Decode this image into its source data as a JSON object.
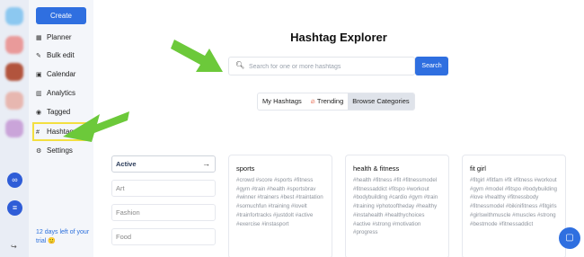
{
  "sidebar": {
    "create_label": "Create",
    "items": [
      {
        "label": "Planner",
        "icon": "grid-icon"
      },
      {
        "label": "Bulk edit",
        "icon": "edit-icon"
      },
      {
        "label": "Calendar",
        "icon": "calendar-icon"
      },
      {
        "label": "Analytics",
        "icon": "chart-icon"
      },
      {
        "label": "Tagged",
        "icon": "user-tag-icon"
      },
      {
        "label": "Hashtags",
        "icon": "hash-icon"
      },
      {
        "label": "Settings",
        "icon": "gear-icon"
      }
    ],
    "trial_text": "12 days left of your trial 🙂"
  },
  "main": {
    "title": "Hashtag Explorer",
    "search": {
      "placeholder": "Search for one or more hashtags",
      "button_label": "Search"
    },
    "tabs": [
      {
        "label": "My Hashtags"
      },
      {
        "label": "Trending"
      },
      {
        "label": "Browse Categories"
      }
    ],
    "categories": [
      {
        "label": "Active"
      },
      {
        "label": "Art"
      },
      {
        "label": "Fashion"
      },
      {
        "label": "Food"
      }
    ],
    "cards": [
      {
        "title": "sports",
        "tags": "#crowd #score #sports #fitness #gym #train #health #sportsbrav #winner #trainers #best #traintation #somuchfun #training #lovelt #trainfortracks #justdolt #active #exercise #instasport"
      },
      {
        "title": "health & fitness",
        "tags": "#health #fitness #fit #fitnessmodel #fitnessaddict #fitspo #workout #bodybuilding #cardio #gym #train #training #photooftheday #healthy #instahealth #healthychoices #active #strong #motivation #progress"
      },
      {
        "title": "fit girl",
        "tags": "#fitgirl #fitfam #fit #fitness #workout #gym #model #fitspo #bodybuilding #love #healthy #fitnessbody #fitnessmodel #bikinifitness #fitgirls #girlswithmuscle #muscles #strong #bestmode #fitnessaddict"
      }
    ]
  },
  "colors": {
    "accent": "#2f6fe0",
    "highlight": "#f3df40",
    "annotation_arrow": "#6cc93a"
  }
}
